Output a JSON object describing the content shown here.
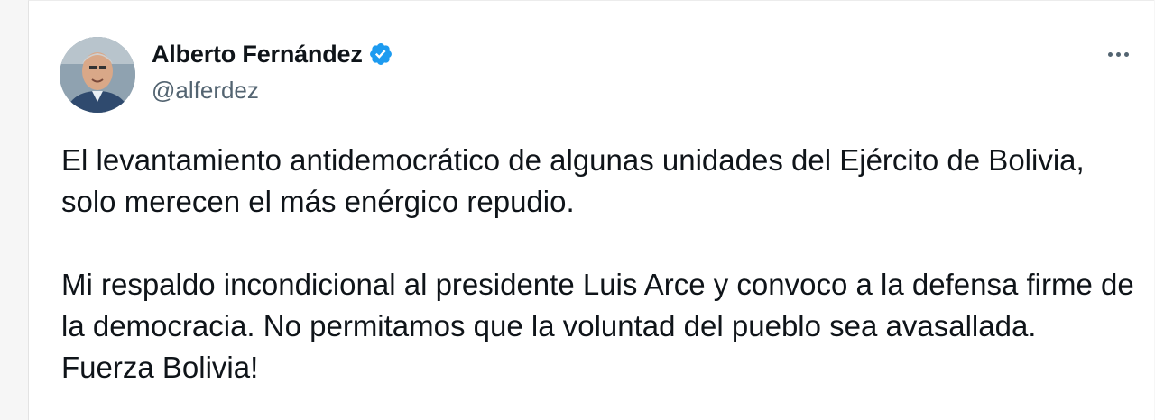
{
  "author": {
    "display_name": "Alberto Fernández",
    "handle": "@alferdez",
    "verified": true
  },
  "tweet": {
    "paragraphs": [
      "El levantamiento antidemocrático de algunas unidades del Ejército de Bolivia, solo merecen el más enérgico repudio.",
      "Mi respaldo incondicional al presidente Luis Arce y convoco a la defensa firme de la democracia. No permitamos que la voluntad del pueblo sea avasallada. Fuerza Bolivia!"
    ]
  },
  "icons": {
    "verified": "verified-badge-icon",
    "more": "more-options-icon"
  },
  "colors": {
    "verified_blue": "#1d9bf0",
    "text": "#0f1419",
    "secondary_text": "#536471"
  }
}
